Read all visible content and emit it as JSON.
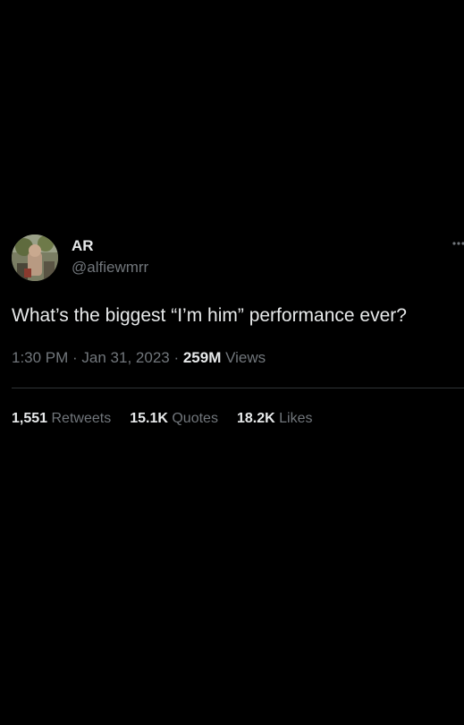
{
  "author": {
    "display_name": "AR",
    "handle": "@alfiewmrr",
    "avatar_icon": "profile-photo"
  },
  "tweet": {
    "text": "What’s the biggest “I’m him” performance ever?"
  },
  "meta": {
    "time": "1:30 PM",
    "separator": " · ",
    "date": "Jan 31, 2023",
    "views_count": "259M",
    "views_label": "Views"
  },
  "stats": {
    "retweets_count": "1,551",
    "retweets_label": "Retweets",
    "quotes_count": "15.1K",
    "quotes_label": "Quotes",
    "likes_count": "18.2K",
    "likes_label": "Likes"
  },
  "colors": {
    "background": "#000000",
    "primary_text": "#e7e9ea",
    "secondary_text": "#71767b",
    "divider": "#2f3336"
  }
}
